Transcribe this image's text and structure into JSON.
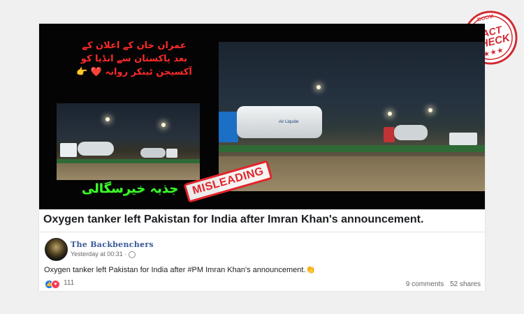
{
  "stamp": {
    "top": "BOOM",
    "line1": "FACT",
    "line2": "CHECK",
    "stars": "★★★"
  },
  "media": {
    "urdu_lines": [
      "عمران خان کے اعلان کے",
      "بعد پاکستان سے انڈیا کو",
      "آکسیجن ٹینکر روانہ ❤️ 👉"
    ],
    "watermark": "جذبہ خیرسگالی",
    "tank_label": "Air Liquide",
    "stamp_label": "MISLEADING"
  },
  "headline": "Oxygen tanker left Pakistan for India after Imran Khan's announcement.",
  "post": {
    "page_name": "The Backbenchers",
    "verified_mark": "ᵞ",
    "timestamp": "Yesterday at 00:31 ·",
    "text": "Oxygen tanker left Pakistan for India after #PM Imran Khan's announcement.",
    "emoji": "👏",
    "reaction_count": "111",
    "comments": "9 comments",
    "shares": "52 shares"
  },
  "colors": {
    "stamp_red": "#d3272f",
    "facebook_blue": "#385898",
    "watermark_green": "#3dff2b"
  }
}
